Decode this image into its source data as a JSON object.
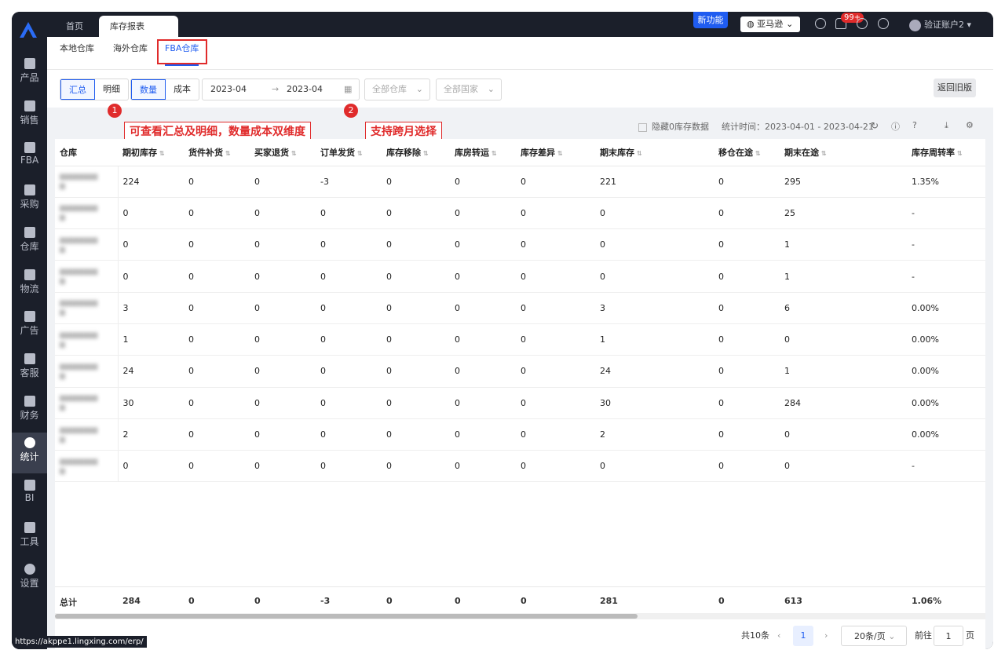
{
  "topbar": {
    "tabs": [
      {
        "label": "首页"
      },
      {
        "label": "库存报表"
      }
    ],
    "close_glyph": "×",
    "new_feature": "新功能",
    "shop": "亚马逊",
    "badge": "99+",
    "user": "验证账户2"
  },
  "sidebar": {
    "items": [
      {
        "label": "产品",
        "icon": "bag-icon"
      },
      {
        "label": "销售",
        "icon": "sale-icon"
      },
      {
        "label": "FBA",
        "icon": "fba-icon"
      },
      {
        "label": "采购",
        "icon": "cart-icon"
      },
      {
        "label": "仓库",
        "icon": "warehouse-icon"
      },
      {
        "label": "物流",
        "icon": "truck-icon"
      },
      {
        "label": "广告",
        "icon": "ad-icon"
      },
      {
        "label": "客服",
        "icon": "mail-icon"
      },
      {
        "label": "财务",
        "icon": "yen-icon"
      },
      {
        "label": "统计",
        "icon": "pie-icon",
        "active": true
      },
      {
        "label": "BI",
        "icon": "bi-icon"
      },
      {
        "label": "工具",
        "icon": "wrench-icon"
      },
      {
        "label": "设置",
        "icon": "gear-icon"
      }
    ]
  },
  "subtabs": [
    {
      "label": "本地仓库"
    },
    {
      "label": "海外仓库"
    },
    {
      "label": "FBA仓库"
    }
  ],
  "toolbar": {
    "mode": [
      "汇总",
      "明细"
    ],
    "measure": [
      "数量",
      "成本"
    ],
    "date_start": "2023-04",
    "date_end": "2023-04",
    "warehouse_placeholder": "全部仓库",
    "country_placeholder": "全部国家",
    "back_label": "返回旧版"
  },
  "callouts": [
    {
      "num": "1",
      "text": "可查看汇总及明细，数量成本双维度"
    },
    {
      "num": "2",
      "text": "支持跨月选择"
    }
  ],
  "stats": {
    "hide_zero": "隐藏0库存数据",
    "time": "统计时间：2023-04-01 - 2023-04-21"
  },
  "table": {
    "headers": [
      "仓库",
      "期初库存",
      "货件补货",
      "买家退货",
      "订单发货",
      "库存移除",
      "库房转运",
      "库存差异",
      "期末库存",
      "移仓在途",
      "期末在途",
      "库存周转率"
    ],
    "rows": [
      [
        "224",
        "0",
        "0",
        "-3",
        "0",
        "0",
        "0",
        "221",
        "0",
        "295",
        "1.35%"
      ],
      [
        "0",
        "0",
        "0",
        "0",
        "0",
        "0",
        "0",
        "0",
        "0",
        "25",
        "-"
      ],
      [
        "0",
        "0",
        "0",
        "0",
        "0",
        "0",
        "0",
        "0",
        "0",
        "1",
        "-"
      ],
      [
        "0",
        "0",
        "0",
        "0",
        "0",
        "0",
        "0",
        "0",
        "0",
        "1",
        "-"
      ],
      [
        "3",
        "0",
        "0",
        "0",
        "0",
        "0",
        "0",
        "3",
        "0",
        "6",
        "0.00%"
      ],
      [
        "1",
        "0",
        "0",
        "0",
        "0",
        "0",
        "0",
        "1",
        "0",
        "0",
        "0.00%"
      ],
      [
        "24",
        "0",
        "0",
        "0",
        "0",
        "0",
        "0",
        "24",
        "0",
        "1",
        "0.00%"
      ],
      [
        "30",
        "0",
        "0",
        "0",
        "0",
        "0",
        "0",
        "30",
        "0",
        "284",
        "0.00%"
      ],
      [
        "2",
        "0",
        "0",
        "0",
        "0",
        "0",
        "0",
        "2",
        "0",
        "0",
        "0.00%"
      ],
      [
        "0",
        "0",
        "0",
        "0",
        "0",
        "0",
        "0",
        "0",
        "0",
        "0",
        "-"
      ]
    ],
    "total": [
      "总计",
      "284",
      "0",
      "0",
      "-3",
      "0",
      "0",
      "0",
      "281",
      "0",
      "613",
      "1.06%"
    ]
  },
  "pager": {
    "total": "共10条",
    "page": "1",
    "page_size": "20条/页",
    "goto": "前往",
    "goto_value": "1",
    "page_suffix": "页"
  },
  "status_url": "https://akppe1.lingxing.com/erp/"
}
